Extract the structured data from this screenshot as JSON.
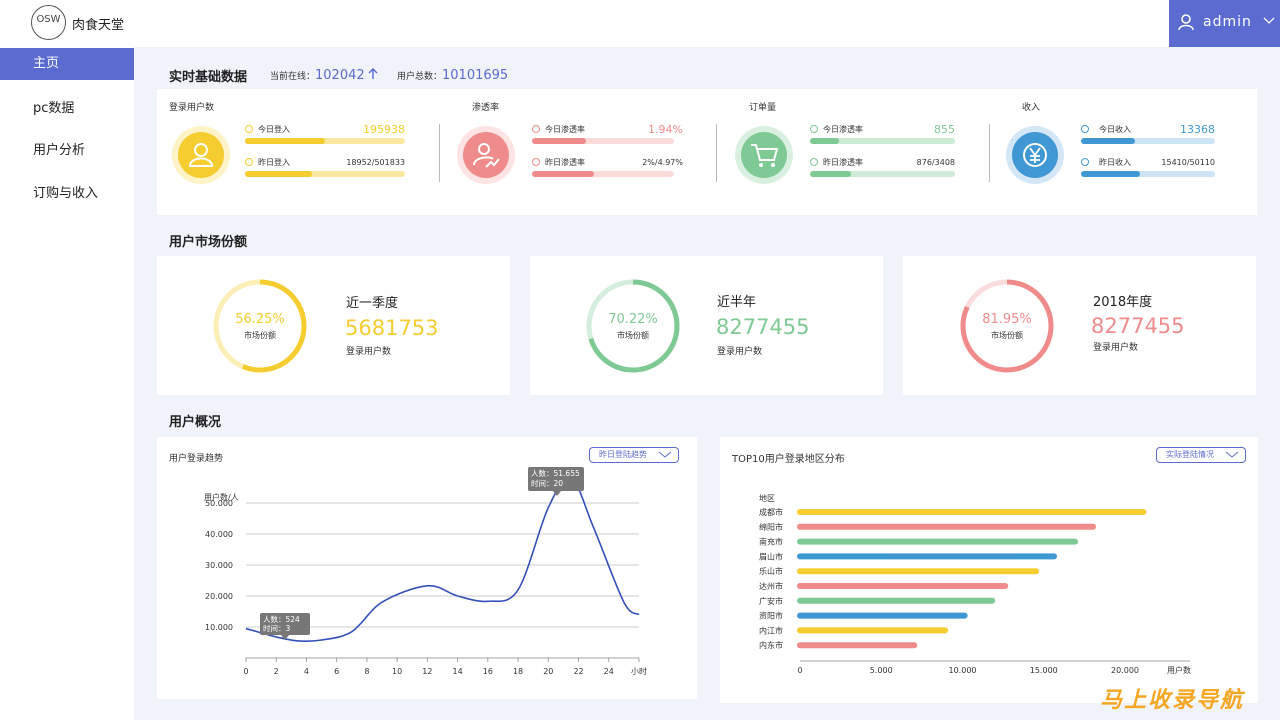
{
  "header": {
    "logo_text": "OSW",
    "brand": "肉食天堂",
    "user": "admin"
  },
  "sidebar": {
    "items": [
      {
        "label": "主页"
      },
      {
        "label": "pc数据"
      },
      {
        "label": "用户分析"
      },
      {
        "label": "订购与收入"
      }
    ]
  },
  "realtime": {
    "title": "实时基础数据",
    "online_label": "当前在线：",
    "online_value": "102042",
    "total_label": "用户总数：",
    "total_value": "10101695",
    "kpis": [
      {
        "title": "登录用户数",
        "color": "#f5cd30",
        "track": "#fbe8a0",
        "rows": [
          {
            "label": "今日登入",
            "value": "195938",
            "fill": 0.5
          },
          {
            "label": "昨日登入",
            "value": "18952/501833",
            "fill": 0.42
          }
        ]
      },
      {
        "title": "渗透率",
        "color": "#ef8b8b",
        "track": "#fbdada",
        "rows": [
          {
            "label": "今日渗透率",
            "value": "1.94%",
            "fill": 0.38
          },
          {
            "label": "昨日渗透率",
            "value": "2%/4.97%",
            "fill": 0.44
          }
        ]
      },
      {
        "title": "订单量",
        "color": "#7fc995",
        "track": "#cdebd6",
        "rows": [
          {
            "label": "今日渗透率",
            "value": "855",
            "fill": 0.2
          },
          {
            "label": "昨日渗透率",
            "value": "876/3408",
            "fill": 0.28
          }
        ]
      },
      {
        "title": "收入",
        "color": "#3f97d4",
        "track": "#cde4f4",
        "rows": [
          {
            "label": "今日收入",
            "value": "13368",
            "fill": 0.4
          },
          {
            "label": "昨日收入",
            "value": "15410/50110",
            "fill": 0.44
          }
        ]
      }
    ]
  },
  "market": {
    "title": "用户市场份额",
    "cards": [
      {
        "pct": "56.25%",
        "pct_value": 0.5625,
        "sub": "市场份额",
        "period": "近一季度",
        "value": "5681753",
        "value_label": "登录用户数",
        "color": "#f5cd30",
        "track": "#fbeeb6"
      },
      {
        "pct": "70.22%",
        "pct_value": 0.7022,
        "sub": "市场份额",
        "period": "近半年",
        "value": "8277455",
        "value_label": "登录用户数",
        "color": "#7fc995",
        "track": "#d4eddc"
      },
      {
        "pct": "81.95%",
        "pct_value": 0.8195,
        "sub": "市场份额",
        "period": "2018年度",
        "value": "8277455",
        "value_label": "登录用户数",
        "color": "#ef8b8b",
        "track": "#fadcdc"
      }
    ]
  },
  "overview": {
    "title": "用户概况",
    "trend": {
      "title": "用户登录趋势",
      "dropdown": "昨日登陆趋势",
      "tooltip_peak": {
        "l1": "人数：51.655",
        "l2": "时间：20"
      },
      "tooltip_low": {
        "l1": "人数：524",
        "l2": "时间：3"
      }
    },
    "region": {
      "title": "TOP10用户登录地区分布",
      "dropdown": "实际登陆情况"
    }
  },
  "chart_data": [
    {
      "type": "line",
      "ylabel": "用户数/人",
      "xlabel": "小时",
      "x_ticks": [
        "0",
        "2",
        "4",
        "6",
        "8",
        "10",
        "12",
        "14",
        "16",
        "18",
        "20",
        "22",
        "24",
        "小时"
      ],
      "y_ticks": [
        "10.000",
        "20.000",
        "30.000",
        "40.000",
        "50.000"
      ],
      "ylim": [
        0,
        60000
      ],
      "series": [
        {
          "color": "#3450b8",
          "x": [
            0,
            2,
            3.5,
            5,
            7,
            9,
            12,
            14,
            16,
            18,
            20,
            21.5,
            23,
            25,
            26
          ],
          "y": [
            9500,
            6800,
            5500,
            5800,
            8500,
            18000,
            23300,
            20000,
            18300,
            22000,
            48500,
            58000,
            42000,
            18000,
            14000
          ]
        }
      ]
    },
    {
      "type": "bar",
      "ylabel": "地区",
      "xlabel": "用户数",
      "categories": [
        "成都市",
        "绵阳市",
        "南充市",
        "眉山市",
        "乐山市",
        "达州市",
        "广安市",
        "资阳市",
        "内江市",
        "内东市"
      ],
      "values": [
        21500,
        18400,
        17300,
        16000,
        14900,
        13000,
        12200,
        10500,
        9300,
        7400
      ],
      "colors": [
        "#f5cd30",
        "#ef8b8b",
        "#7fc995",
        "#3f97d4",
        "#f5cd30",
        "#ef8b8b",
        "#7fc995",
        "#3f97d4",
        "#f5cd30",
        "#ef8b8b"
      ],
      "x_ticks": [
        "0",
        "5.000",
        "10.000",
        "15.000",
        "20.000"
      ],
      "xlim": [
        0,
        24000
      ]
    }
  ],
  "watermark": "马上收录导航"
}
